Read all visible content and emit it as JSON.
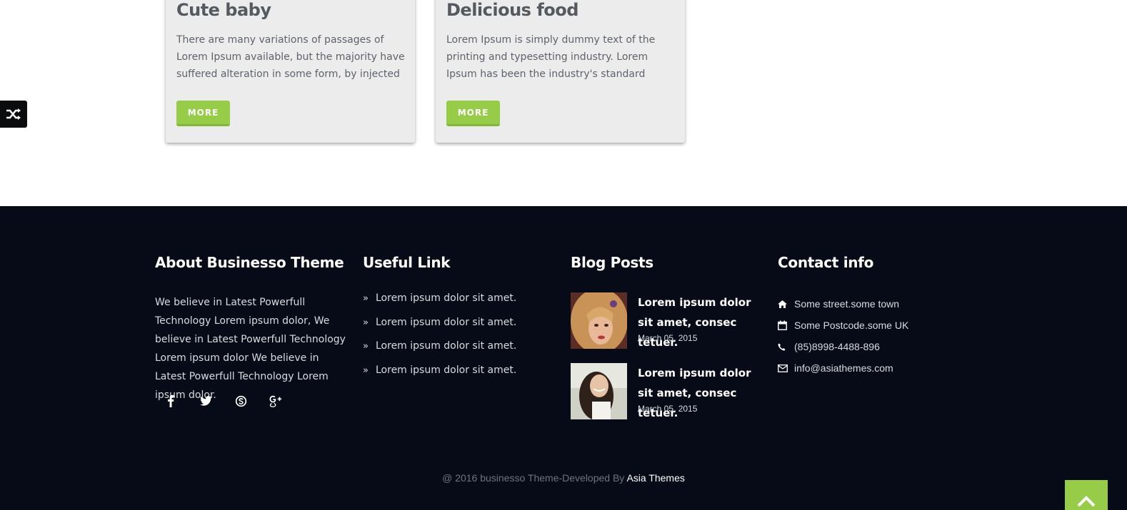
{
  "cards": [
    {
      "title": "Cute baby",
      "text": "There are many variations of passages of Lorem Ipsum available, but the majority have suffered alteration in some form, by injected humour, or",
      "button_label": "MORE"
    },
    {
      "title": "Delicious food",
      "text": "Lorem Ipsum is simply dummy text of the printing and typesetting industry. Lorem Ipsum has been the industry's standard dummy text ever since the",
      "button_label": "MORE"
    }
  ],
  "footer": {
    "about": {
      "heading": "About Businesso Theme",
      "text": "We believe in Latest Powerfull Technology Lorem ipsum dolor, We believe in Latest Powerfull Technology Lorem ipsum dolor We believe in Latest Powerfull Technology Lorem ipsum dolor.",
      "socials": [
        "facebook-icon",
        "twitter-icon",
        "skype-icon",
        "google-plus-icon"
      ]
    },
    "links": {
      "heading": "Useful Link",
      "items": [
        "Lorem ipsum dolor sit amet.",
        "Lorem ipsum dolor sit amet.",
        "Lorem ipsum dolor sit amet.",
        "Lorem ipsum dolor sit amet."
      ]
    },
    "blog": {
      "heading": "Blog Posts",
      "posts": [
        {
          "title": "Lorem ipsum dolor sit amet, consec tetuer.",
          "date": "March 05, 2015"
        },
        {
          "title": "Lorem ipsum dolor sit amet, consec tetuer.",
          "date": "March 05, 2015"
        }
      ]
    },
    "contact": {
      "heading": "Contact info",
      "items": [
        {
          "icon": "home-icon",
          "text": "Some street.some town"
        },
        {
          "icon": "calendar-icon",
          "text": "Some Postcode.some UK"
        },
        {
          "icon": "phone-icon",
          "text": "(85)8998-4488-896"
        },
        {
          "icon": "envelope-icon",
          "text": "info@asiathemes.com"
        }
      ]
    },
    "copyright_prefix": "@ 2016 businesso Theme-Developed By",
    "copyright_link": "Asia Themes"
  },
  "colors": {
    "accent_green": "#96cc48",
    "footer_bg": "#070b17",
    "card_bg": "#ececec"
  }
}
